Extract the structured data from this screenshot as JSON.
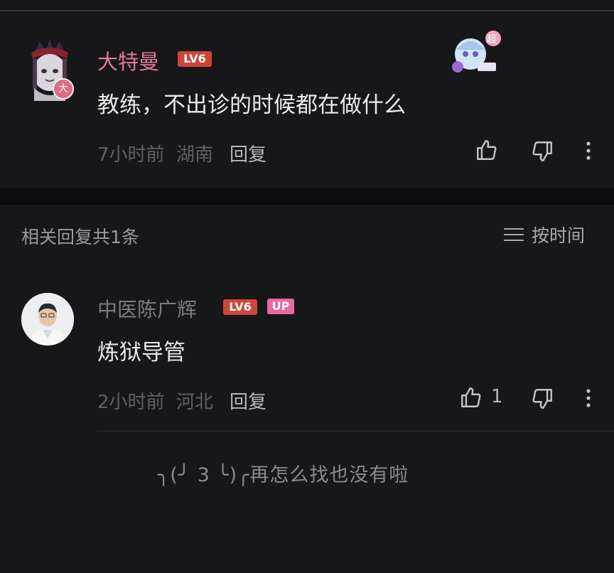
{
  "main_comment": {
    "username": "大特曼",
    "level": "LV6",
    "avatar_badge": "大",
    "text": "教练，不出诊的时候都在做什么",
    "time": "7小时前",
    "location": "湖南",
    "reply_label": "回复",
    "sticker_badge": "超"
  },
  "replies_section": {
    "header": "相关回复共1条",
    "sort_label": "按时间"
  },
  "reply": {
    "username": "中医陈广辉",
    "level": "LV6",
    "up_badge": "UP",
    "text": "炼狱导管",
    "time": "2小时前",
    "location": "河北",
    "reply_label": "回复",
    "like_count": "1"
  },
  "end_message": "╮(╯ 3 ╰)╭再怎么找也没有啦",
  "colors": {
    "background": "#17171a",
    "username_pink": "#e07a9a",
    "level_badge": "#d0453a",
    "up_badge": "#e8699e",
    "muted_text": "#5f5f64"
  },
  "icons": [
    "thumb-up-icon",
    "thumb-down-icon",
    "more-vertical-icon",
    "sort-lines-icon"
  ]
}
